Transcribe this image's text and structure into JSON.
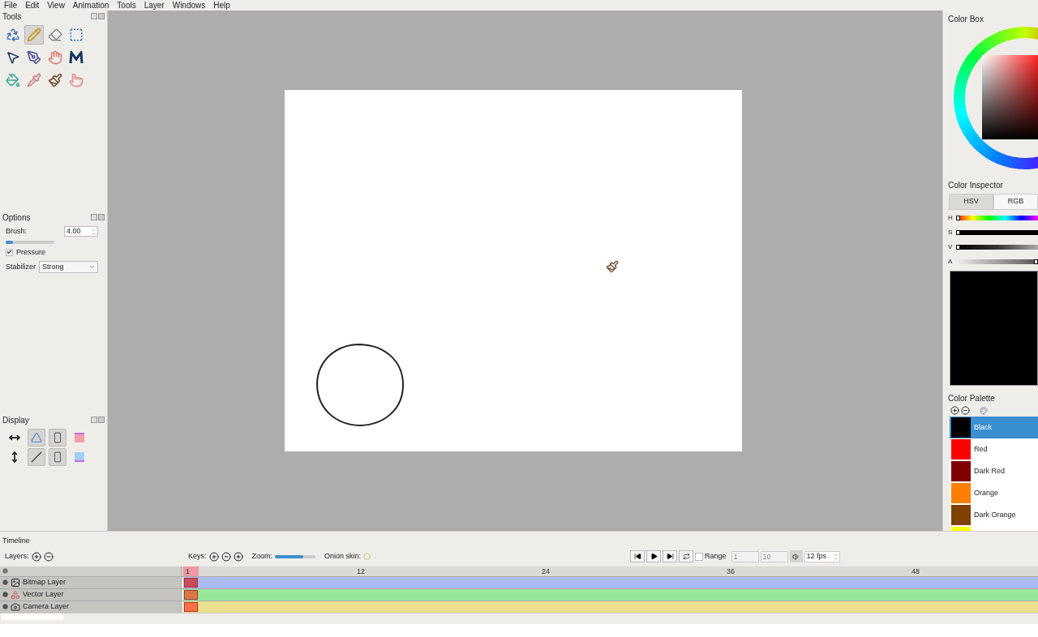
{
  "menu": [
    "File",
    "Edit",
    "View",
    "Animation",
    "Tools",
    "Layer",
    "Windows",
    "Help"
  ],
  "tools_panel": {
    "title": "Tools",
    "tools": [
      {
        "kind": "clear",
        "selected": false
      },
      {
        "kind": "pencil",
        "selected": true
      },
      {
        "kind": "eraser",
        "selected": false
      },
      {
        "kind": "select",
        "selected": false
      },
      {
        "kind": "move",
        "selected": false
      },
      {
        "kind": "pen",
        "selected": false
      },
      {
        "kind": "hand",
        "selected": false
      },
      {
        "kind": "polyline",
        "selected": false
      },
      {
        "kind": "bucket",
        "selected": false
      },
      {
        "kind": "eyedropper",
        "selected": false
      },
      {
        "kind": "brush",
        "selected": false
      },
      {
        "kind": "smudge",
        "selected": false
      }
    ]
  },
  "options_panel": {
    "title": "Options",
    "brush_label": "Brush:",
    "brush": {
      "level": 0.15,
      "value": "4.00"
    },
    "pressure": {
      "label": "Pressure",
      "checked": true
    },
    "stabilizer": {
      "label": "Stabilizer",
      "value": "Strong"
    }
  },
  "display_panel": {
    "title": "Display",
    "buttons": [
      {
        "kind": "flip-h",
        "pressed": false
      },
      {
        "kind": "outline",
        "pressed": true
      },
      {
        "kind": "page",
        "pressed": true
      },
      {
        "kind": "onion-prev",
        "pressed": false
      },
      {
        "kind": "flip-v",
        "pressed": false
      },
      {
        "kind": "line",
        "pressed": true
      },
      {
        "kind": "page2",
        "pressed": true
      },
      {
        "kind": "onion-next",
        "pressed": false
      }
    ]
  },
  "color_box": {
    "title": "Color Box"
  },
  "color_inspector": {
    "title": "Color Inspector",
    "tabs": [
      {
        "label": "HSV",
        "selected": true
      },
      {
        "label": "RGB",
        "selected": false
      }
    ],
    "channels": [
      {
        "kind": "hue",
        "name": "H",
        "level": 0
      },
      {
        "kind": "sat",
        "name": "S",
        "level": 0
      },
      {
        "kind": "val",
        "name": "V",
        "level": 0
      },
      {
        "kind": "alpha",
        "name": "A",
        "level": 1
      }
    ],
    "preview": {
      "color": "#000000"
    }
  },
  "color_palette": {
    "title": "Color Palette",
    "colors": [
      {
        "name": "Black",
        "color": "#000000",
        "selected": true
      },
      {
        "name": "Red",
        "color": "#ff0000",
        "selected": false
      },
      {
        "name": "Dark Red",
        "color": "#800000",
        "selected": false
      },
      {
        "name": "Orange",
        "color": "#ff8000",
        "selected": false
      },
      {
        "name": "Dark Orange",
        "color": "#804000",
        "selected": false
      },
      {
        "color": "#ffff00",
        "selected": false
      }
    ]
  },
  "timeline": {
    "title": "Timeline",
    "layers_label": "Layers:",
    "keys_label": "Keys:",
    "zoom_label": "Zoom:",
    "zoom": {
      "level": 0.7
    },
    "onion_label": "Onion skin:",
    "range": {
      "label": "Range",
      "checked": false,
      "start": "1",
      "end": "10"
    },
    "fps": "12 fps",
    "ruler": [
      "1",
      "12",
      "24",
      "36",
      "48"
    ],
    "layers": [
      {
        "kind": "bitmap",
        "name": "Bitmap Layer",
        "color": "#aabbf2",
        "keyframe": {
          "color": "#c94a5a"
        }
      },
      {
        "kind": "vector",
        "name": "Vector Layer",
        "color": "#99e699",
        "keyframe": {
          "color": "#d8784a"
        }
      },
      {
        "kind": "camera",
        "name": "Camera Layer",
        "color": "#ebe08f",
        "keyframe": {
          "color": "#ff7043"
        }
      }
    ]
  }
}
